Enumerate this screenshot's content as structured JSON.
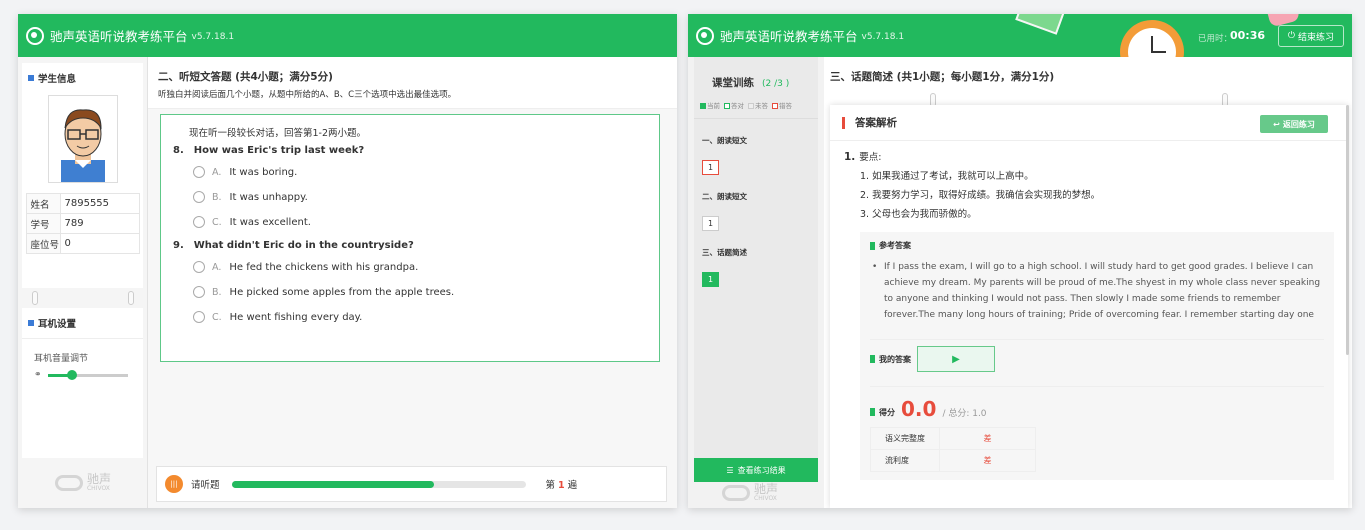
{
  "app": {
    "title": "驰声英语听说教考练平台",
    "version": "v5.7.18.1"
  },
  "left": {
    "student_section": "学生信息",
    "fields": [
      {
        "label": "姓名",
        "value": "7895555"
      },
      {
        "label": "学号",
        "value": "789"
      },
      {
        "label": "座位号",
        "value": "0"
      }
    ],
    "headset_section": "耳机设置",
    "volume_label": "耳机音量调节",
    "volume_level": 0.3,
    "brand_name": "驰声",
    "brand_sub": "CHIVOX",
    "section_title": "二、听短文答题 (共4小题；满分5分)",
    "instruction": "听独白并阅读后面几个小题，从题中所给的A、B、C三个选项中选出最佳选项。",
    "intro": "现在听一段较长对话，回答第1-2两小题。",
    "questions": [
      {
        "num": "8.",
        "text": "How was Eric's trip last week?",
        "options": [
          {
            "letter": "A.",
            "text": "It was boring."
          },
          {
            "letter": "B.",
            "text": "It was unhappy."
          },
          {
            "letter": "C.",
            "text": "It was excellent."
          }
        ]
      },
      {
        "num": "9.",
        "text": "What didn't Eric do in the countryside?",
        "options": [
          {
            "letter": "A.",
            "text": "He fed the chickens with his grandpa."
          },
          {
            "letter": "B.",
            "text": "He picked some apples from the apple trees."
          },
          {
            "letter": "C.",
            "text": "He went fishing every day."
          }
        ]
      }
    ],
    "listen_label": "请听题",
    "play_badge": "|||",
    "progress": 0.69,
    "pass_prefix": "第",
    "pass_num": "1",
    "pass_suffix": "遍"
  },
  "right": {
    "timer_label": "已用时：",
    "timer_value": "00:36",
    "end_button": "结束练习",
    "class_title": "课堂训练",
    "page": "(2 /3 )",
    "legend": [
      {
        "label": "当前",
        "color": "#22b95e"
      },
      {
        "label": "答对",
        "color": "#ffffff"
      },
      {
        "label": "未答",
        "color": "#eeeeee"
      },
      {
        "label": "错答",
        "color": "#e74c3c"
      }
    ],
    "sections": [
      {
        "name": "一、朗读短文",
        "chip": "1"
      },
      {
        "name": "二、朗读短文",
        "chip": "1"
      },
      {
        "name": "三、话题简述",
        "chip": "1"
      }
    ],
    "view_results": "查看练习结果",
    "section_title": "三、话题简述 (共1小题；每小题1分，满分1分)",
    "analysis_title": "答案解析",
    "back_button": "返回练习",
    "key_num": "1.",
    "key_label": "要点:",
    "points": [
      "1. 如果我通过了考试，我就可以上高中。",
      "2. 我要努力学习，取得好成绩。我确信会实现我的梦想。",
      "3. 父母也会为我而骄傲的。"
    ],
    "ref_label": "参考答案",
    "ref_text": "If I pass the exam, I will go to a high school. I will study hard to get good grades. I believe I can achieve my dream. My parents will be proud of me.The shyest in my whole class never speaking to anyone and thinking I would not pass. Then slowly I made some friends to remember forever.The many long hours of training; Pride of overcoming fear. I remember starting day one",
    "my_answer_label": "我的答案",
    "score_label": "得分",
    "score": "0.0",
    "total": "/ 总分: 1.0",
    "criteria": [
      {
        "name": "语义完整度",
        "level": "差"
      },
      {
        "name": "流利度",
        "level": "差"
      }
    ]
  }
}
